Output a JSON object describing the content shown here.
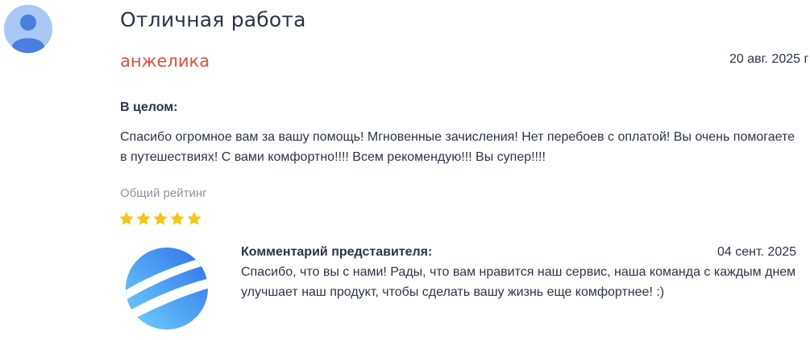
{
  "review": {
    "title": "Отличная работа",
    "author": "анжелика",
    "date": "20 авг. 2025 г",
    "section_label": "В целом:",
    "text": "Спасибо огромное вам за вашу помощь! Мгновенные зачисления! Нет перебоев с оплатой! Вы очень помогаете в путешествиях! С вами комфортно!!!! Всем рекомендую!!! Вы супер!!!!",
    "rating_label": "Общий рейтинг",
    "rating": 5,
    "rating_max": 5,
    "star_color": "#f5c518"
  },
  "reply": {
    "heading": "Комментарий представителя:",
    "date": "04 сент. 2025",
    "text": "Спасибо, что вы с нами! Рады, что вам нравится наш сервис, наша команда с каждым днем улучшает наш продукт, чтобы сделать вашу жизнь еще комфортнее! :)"
  },
  "icons": {
    "user_avatar": "user-avatar-icon",
    "company_logo": "company-logo-globe-icon",
    "star": "star-icon"
  },
  "colors": {
    "author": "#d9503f",
    "text": "#2b3445",
    "muted": "#8d939c",
    "avatar_bg": "#a9c8f5",
    "avatar_fg": "#4a7fe0"
  }
}
